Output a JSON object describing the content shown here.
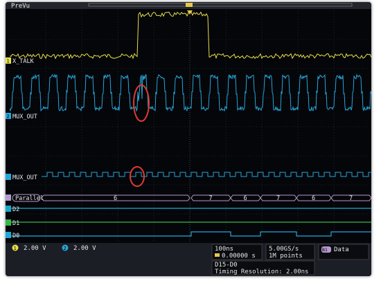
{
  "window": {
    "title": "PreVu"
  },
  "channels": [
    {
      "id": "1",
      "name": "X_TALK",
      "color": "#e8e049"
    },
    {
      "id": "2",
      "name": "MUX_OUT",
      "color": "#27a6d9"
    },
    {
      "id": "D1",
      "name": "MUX_OUT",
      "color": "#27a6d9"
    },
    {
      "id": "B1",
      "name": "Parallel",
      "color": "#b59ad0"
    },
    {
      "id": "D15",
      "name": "D2",
      "color": "#1aa9c9"
    },
    {
      "id": "D1b",
      "name": "D1",
      "color": "#3bb74a"
    },
    {
      "id": "D0",
      "name": "D0",
      "color": "#27a6d9"
    }
  ],
  "bus_values": [
    "6",
    "7",
    "6",
    "7",
    "6",
    "7"
  ],
  "status": {
    "ch1_scale": "2.00 V",
    "ch2_scale": "2.00 V",
    "ch1_num": "1",
    "ch2_num": "2",
    "timebase": "100ns",
    "trigger_pos": "0.00000 s",
    "sample_rate": "5.00GS/s",
    "record_length": "1M points",
    "bus_label": "Data",
    "bus_id": "B1",
    "digital_range": "D15-D0",
    "timing_res": "Timing Resolution: 2.00ns"
  }
}
